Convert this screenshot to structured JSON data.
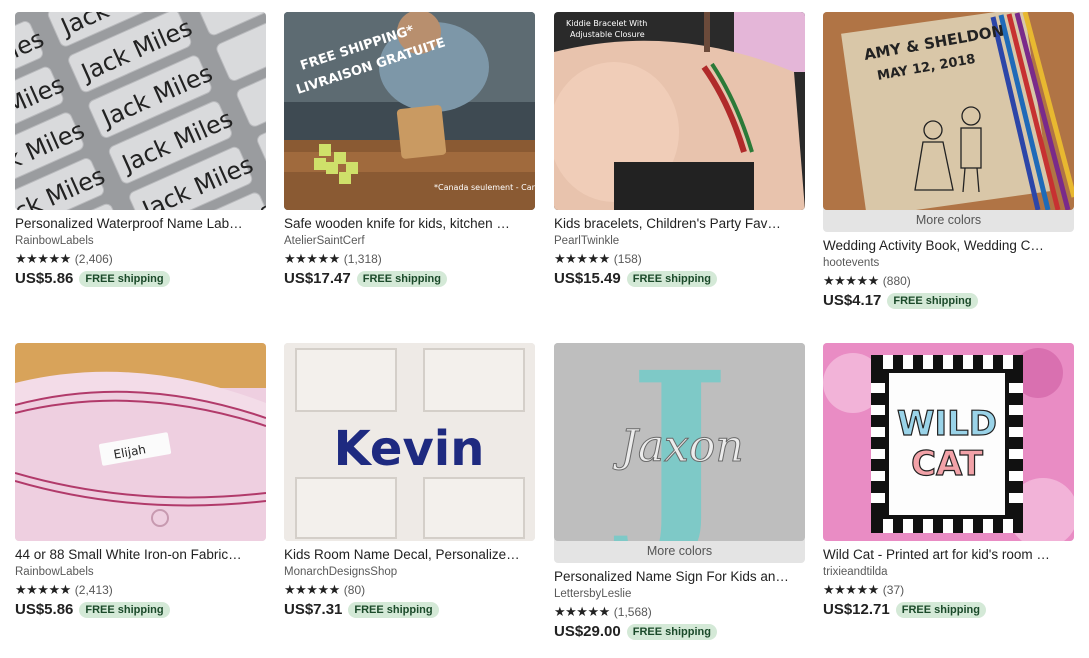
{
  "more_colors_label": "More colors",
  "stars": "★★★★★",
  "listings": [
    {
      "title": "Personalized Waterproof Name Lab…",
      "shop": "RainbowLabels",
      "reviews": "(2,406)",
      "price": "US$5.86",
      "shipping": "FREE shipping"
    },
    {
      "title": "Safe wooden knife for kids, kitchen …",
      "shop": "AtelierSaintCerf",
      "reviews": "(1,318)",
      "price": "US$17.47",
      "shipping": "FREE shipping",
      "image_text": {
        "line1": "FREE SHIPPING*",
        "line2": "LIVRAISON GRATUITE",
        "footnote": "*Canada seulement - Canada only"
      }
    },
    {
      "title": "Kids bracelets, Children's Party Fav…",
      "shop": "PearlTwinkle",
      "reviews": "(158)",
      "price": "US$15.49",
      "shipping": "FREE shipping",
      "image_text": {
        "line1": "Kiddie Bracelet With",
        "line2": "Adjustable Closure"
      }
    },
    {
      "title": "Wedding Activity Book, Wedding C…",
      "shop": "hootevents",
      "reviews": "(880)",
      "price": "US$4.17",
      "shipping": "FREE shipping",
      "image_text": {
        "line1": "AMY & SHELDON",
        "line2": "MAY 12, 2018"
      }
    },
    {
      "title": "44 or 88 Small White Iron-on Fabric…",
      "shop": "RainbowLabels",
      "reviews": "(2,413)",
      "price": "US$5.86",
      "shipping": "FREE shipping",
      "image_text": {
        "label": "Elijah"
      }
    },
    {
      "title": "Kids Room Name Decal, Personalize…",
      "shop": "MonarchDesignsShop",
      "reviews": "(80)",
      "price": "US$7.31",
      "shipping": "FREE shipping",
      "image_text": {
        "name": "Kevin"
      }
    },
    {
      "title": "Personalized Name Sign For Kids an…",
      "shop": "LettersbyLeslie",
      "reviews": "(1,568)",
      "price": "US$29.00",
      "shipping": "FREE shipping",
      "image_text": {
        "letter": "J",
        "name": "Jaxon"
      }
    },
    {
      "title": "Wild Cat - Printed art for kid's room …",
      "shop": "trixieandtilda",
      "reviews": "(37)",
      "price": "US$12.71",
      "shipping": "FREE shipping",
      "image_text": {
        "line1": "WILD",
        "line2": "CAT"
      }
    }
  ],
  "label_sheet_text": "Jack Miles"
}
